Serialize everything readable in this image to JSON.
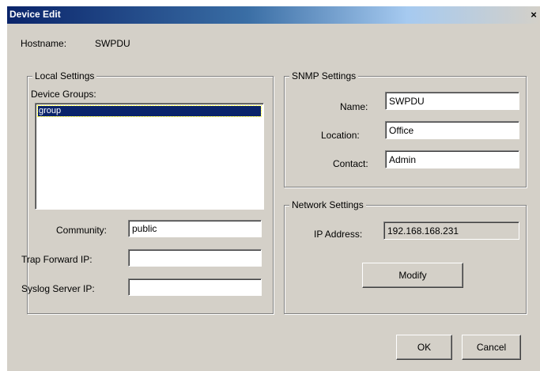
{
  "window": {
    "title": "Device Edit",
    "close_glyph": "×"
  },
  "hostname": {
    "label": "Hostname:",
    "value": "SWPDU"
  },
  "local_settings": {
    "legend": "Local Settings",
    "device_groups_label": "Device Groups:",
    "device_groups": [
      "group"
    ],
    "community_label": "Community:",
    "community_value": "public",
    "trap_forward_label": "Trap Forward IP:",
    "trap_forward_value": "",
    "syslog_label": "Syslog Server IP:",
    "syslog_value": ""
  },
  "snmp_settings": {
    "legend": "SNMP Settings",
    "name_label": "Name:",
    "name_value": "SWPDU",
    "location_label": "Location:",
    "location_value": "Office",
    "contact_label": "Contact:",
    "contact_value": "Admin"
  },
  "network_settings": {
    "legend": "Network Settings",
    "ip_label": "IP Address:",
    "ip_value": "192.168.168.231",
    "modify_label": "Modify"
  },
  "buttons": {
    "ok": "OK",
    "cancel": "Cancel"
  },
  "colors": {
    "dialog_bg": "#d4d0c8",
    "title_bar": "#0a246a",
    "selection": "#0a246a"
  },
  "icons": {
    "close": "close-icon"
  }
}
